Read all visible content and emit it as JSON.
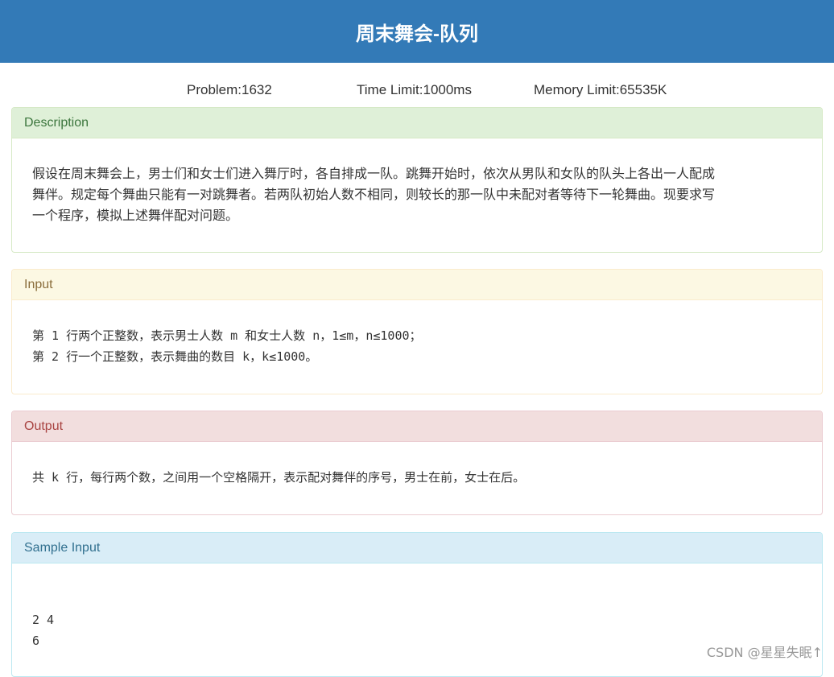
{
  "header": {
    "title": "周末舞会-队列"
  },
  "limits": {
    "problem": "Problem:1632",
    "time": "Time Limit:1000ms",
    "memory": "Memory Limit:65535K"
  },
  "description": {
    "heading": "Description",
    "lines": [
      "假设在周末舞会上，男士们和女士们进入舞厅时，各自排成一队。跳舞开始时，依次从男队和女队的队头上各出一人配成",
      "舞伴。规定每个舞曲只能有一对跳舞者。若两队初始人数不相同，则较长的那一队中未配对者等待下一轮舞曲。现要求写",
      "一个程序，模拟上述舞伴配对问题。"
    ]
  },
  "input": {
    "heading": "Input",
    "lines": [
      "第 1 行两个正整数，表示男士人数 m 和女士人数 n，1≤m，n≤1000；",
      "第 2 行一个正整数，表示舞曲的数目 k，k≤1000。"
    ]
  },
  "output": {
    "heading": "Output",
    "text": "共 k 行，每行两个数，之间用一个空格隔开，表示配对舞伴的序号，男士在前，女士在后。"
  },
  "sample_input": {
    "heading": "Sample Input",
    "lines": [
      "2 4",
      "6"
    ]
  },
  "watermark": "CSDN @星星失眠↑"
}
